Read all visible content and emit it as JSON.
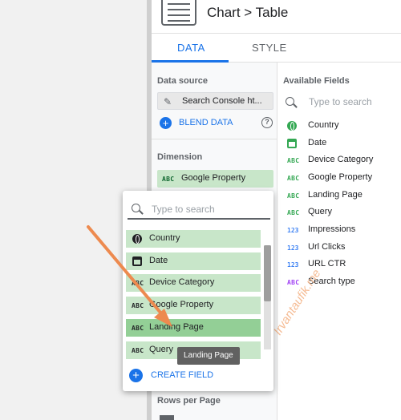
{
  "header": {
    "title": "Chart > Table"
  },
  "tabs": {
    "data": "DATA",
    "style": "STYLE"
  },
  "setup": {
    "data_source_label": "Data source",
    "data_source_value": "Search Console ht...",
    "blend_label": "BLEND DATA",
    "dimension_label": "Dimension",
    "dimension_value": "Google Property",
    "rows_per_page_label": "Rows per Page"
  },
  "available": {
    "heading": "Available Fields",
    "search_placeholder": "Type to search",
    "fields": [
      {
        "label": "Country",
        "icon": "globe-icon",
        "type": "geo"
      },
      {
        "label": "Date",
        "icon": "calendar-icon",
        "type": "date"
      },
      {
        "label": "Device Category",
        "icon": "ABC",
        "type": "text"
      },
      {
        "label": "Google Property",
        "icon": "ABC",
        "type": "text"
      },
      {
        "label": "Landing Page",
        "icon": "ABC",
        "type": "text"
      },
      {
        "label": "Query",
        "icon": "ABC",
        "type": "text"
      },
      {
        "label": "Impressions",
        "icon": "123",
        "type": "number"
      },
      {
        "label": "Url Clicks",
        "icon": "123",
        "type": "number"
      },
      {
        "label": "URL CTR",
        "icon": "123",
        "type": "number"
      },
      {
        "label": "Search type",
        "icon": "ABC",
        "type": "text-purple"
      }
    ]
  },
  "dropdown": {
    "search_placeholder": "Type to search",
    "options": [
      {
        "label": "Country",
        "icon": "globe-icon"
      },
      {
        "label": "Date",
        "icon": "calendar-icon"
      },
      {
        "label": "Device Category",
        "icon": "ABC"
      },
      {
        "label": "Google Property",
        "icon": "ABC"
      },
      {
        "label": "Landing Page",
        "icon": "ABC",
        "hovered": true
      },
      {
        "label": "Query",
        "icon": "ABC"
      }
    ],
    "create_field_label": "CREATE FIELD",
    "tooltip": "Landing Page"
  },
  "icon_text": {
    "abc": "ABC",
    "num": "123",
    "plus": "+",
    "help": "?",
    "pencil": "✎"
  },
  "watermark": "Irvantaufik.me",
  "colors": {
    "accent_blue": "#1a73e8",
    "chip_green": "#c8e6c9",
    "chip_hover_green": "#93cf96",
    "field_green": "#34a853",
    "number_blue": "#4285f4",
    "purple": "#a142f4",
    "annotation_arrow": "#ed8a4f"
  }
}
